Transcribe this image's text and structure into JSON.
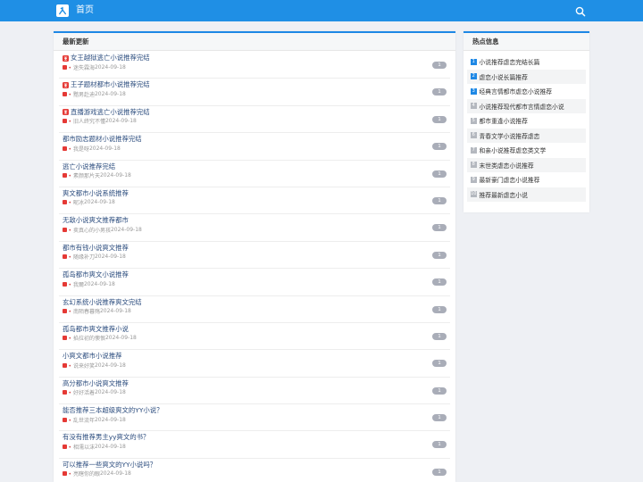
{
  "header": {
    "home_label": "首页"
  },
  "colors": {
    "header_bg": "#1f8fe5",
    "accent": "#1e88e5",
    "pin_red": "#e53935",
    "badge_gray": "#a9adb8"
  },
  "latest": {
    "title": "最新更新",
    "items": [
      {
        "title": "女王越狱逃亡小说推荐完结",
        "author": "迷失霖海",
        "date": "2024-09-18",
        "count": "1",
        "pinned": true
      },
      {
        "title": "王子题材都市小说推荐完结",
        "author": "黯男赴迪",
        "date": "2024-09-18",
        "count": "1",
        "pinned": true
      },
      {
        "title": "直播游戏逃亡小说推荐完结",
        "author": "旧人终究不懂",
        "date": "2024-09-18",
        "count": "1",
        "pinned": true
      },
      {
        "title": "都市励志题材小说推荐完结",
        "author": "我是呀",
        "date": "2024-09-18",
        "count": "1",
        "pinned": false
      },
      {
        "title": "逃亡小说推荐完结",
        "author": "素颜那片天",
        "date": "2024-09-18",
        "count": "1",
        "pinned": false
      },
      {
        "title": "爽文都市小说系统推荐",
        "author": "昵冰",
        "date": "2024-09-18",
        "count": "1",
        "pinned": false
      },
      {
        "title": "无敌小说爽文推荐都市",
        "author": "卖真心的小男孩",
        "date": "2024-09-18",
        "count": "1",
        "pinned": false
      },
      {
        "title": "都市有钱小说爽文推荐",
        "author": "随缘补刀",
        "date": "2024-09-18",
        "count": "1",
        "pinned": false
      },
      {
        "title": "孤岛都市爽文小说推荐",
        "author": "我爾",
        "date": "2024-09-18",
        "count": "1",
        "pinned": false
      },
      {
        "title": "玄幻系统小说推荐爽文完结",
        "author": "南陌春暮殇",
        "date": "2024-09-18",
        "count": "1",
        "pinned": false
      },
      {
        "title": "孤岛都市爽文推荐小说",
        "author": "掐拉初的懊恨",
        "date": "2024-09-18",
        "count": "1",
        "pinned": false
      },
      {
        "title": "小爽文都市小说推荐",
        "author": "说来好笑",
        "date": "2024-09-18",
        "count": "1",
        "pinned": false
      },
      {
        "title": "高分都市小说爽文推荐",
        "author": "好好活着",
        "date": "2024-09-18",
        "count": "1",
        "pinned": false
      },
      {
        "title": "能否推荐三本超级爽文的YY小说？",
        "author": "乱世流年",
        "date": "2024-09-18",
        "count": "1",
        "pinned": false
      },
      {
        "title": "有没有推荐男主yy爽文的书？",
        "author": "相濡以沫",
        "date": "2024-09-18",
        "count": "1",
        "pinned": false
      },
      {
        "title": "可以推荐一些爽文的YY小说吗？",
        "author": "亮瞎你的眼",
        "date": "2024-09-18",
        "count": "1",
        "pinned": false
      }
    ]
  },
  "hot": {
    "title": "热点信息",
    "items": [
      {
        "rank": "1",
        "title": "小说推荐虐恋完结长篇"
      },
      {
        "rank": "2",
        "title": "虐恋小说长篇推荐"
      },
      {
        "rank": "3",
        "title": "经典言情都市虐恋小说推荐"
      },
      {
        "rank": "4",
        "title": "小说推荐现代都市言情虐恋小说"
      },
      {
        "rank": "5",
        "title": "都市重逢小说推荐"
      },
      {
        "rank": "6",
        "title": "青春文学小说推荐虐恋"
      },
      {
        "rank": "7",
        "title": "和亲小说推荐虐恋类文学"
      },
      {
        "rank": "8",
        "title": "末世类虐恋小说推荐"
      },
      {
        "rank": "9",
        "title": "最新豪门虐恋小说推荐"
      },
      {
        "rank": "10",
        "title": "推荐最新虐恋小说"
      }
    ]
  }
}
